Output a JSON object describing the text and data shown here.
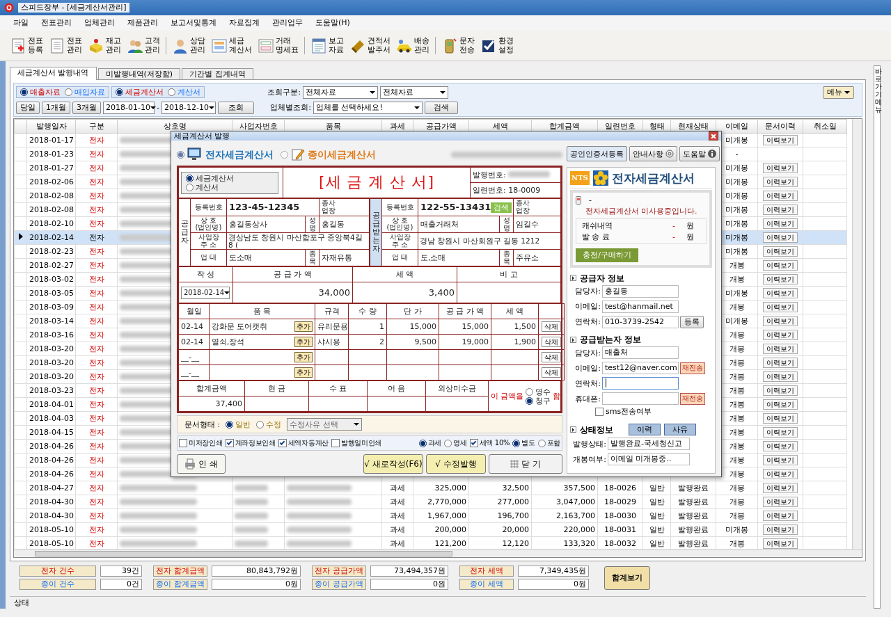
{
  "window": {
    "title": "스피드장부 - [세금계산서관리]"
  },
  "menu": [
    "파일",
    "전표관리",
    "업체관리",
    "제품관리",
    "보고서및통계",
    "자료집계",
    "관리업무",
    "도움말(H)"
  ],
  "toolbar_groups": [
    [
      "전표\n등록",
      "전표\n관리",
      "재고\n관리",
      "고객\n관리"
    ],
    [
      "상담\n관리",
      "세금\n계산서",
      "거래\n명세표"
    ],
    [
      "보고\n자료",
      "견적서\n발주서",
      "배송\n관리"
    ],
    [
      "문자\n전송",
      "환경\n설정"
    ]
  ],
  "side_tab": "바로가기 메뉴",
  "tabs": [
    {
      "label": "세금계산서 발행내역",
      "selected": true
    },
    {
      "label": "미발행내역(저장함)",
      "selected": false
    },
    {
      "label": "기간별 집계내역",
      "selected": false
    }
  ],
  "filters": {
    "source": [
      {
        "label": "매출자료",
        "selected": true,
        "kind": "sales"
      },
      {
        "label": "매입자료",
        "selected": false,
        "kind": "purchase"
      }
    ],
    "doc_type": [
      {
        "label": "세금계산서",
        "selected": true,
        "kind": "sales"
      },
      {
        "label": "계산서",
        "selected": false,
        "kind": "purchase"
      }
    ],
    "period_buttons": [
      "당일",
      "1개월",
      "3개월"
    ],
    "date_from": "2018-01-10",
    "date_sep": "-",
    "date_to": "2018-12-10",
    "search_button": "조회",
    "query_label": "조회구분:",
    "query_select_1": "전체자료",
    "query_select_2": "전체자료",
    "company_label": "업체별조회:",
    "company_select": "업체를 선택하세요!",
    "company_search_button": "검색",
    "menu_button": "메뉴"
  },
  "table": {
    "columns": [
      "발행일자",
      "구분",
      "상호명",
      "사업자번호",
      "품목",
      "과세",
      "공급가액",
      "세액",
      "합계금액",
      "일련번호",
      "형태",
      "현재상태",
      "이메일",
      "문서이력",
      "취소일"
    ],
    "rows": [
      {
        "date": "2018-01-17",
        "kind": "전자",
        "email": "미개봉",
        "history_button": "이력보기",
        "selected": false
      },
      {
        "date": "2018-01-23",
        "kind": "전자",
        "email": "-",
        "selected": false
      },
      {
        "date": "2018-01-27",
        "kind": "전자",
        "email": "미개봉",
        "history_button": "이력보기",
        "selected": false
      },
      {
        "date": "2018-02-06",
        "kind": "전자",
        "email": "미개봉",
        "history_button": "이력보기",
        "selected": false
      },
      {
        "date": "2018-02-08",
        "kind": "전자",
        "email": "미개봉",
        "history_button": "이력보기",
        "selected": false
      },
      {
        "date": "2018-02-08",
        "kind": "전자",
        "email": "미개봉",
        "history_button": "이력보기",
        "selected": false
      },
      {
        "date": "2018-02-10",
        "kind": "전자",
        "email": "미개봉",
        "history_button": "이력보기",
        "selected": false
      },
      {
        "date": "2018-02-14",
        "kind": "전자",
        "email": "미개봉",
        "history_button": "이력보기",
        "selected": true
      },
      {
        "date": "2018-02-23",
        "kind": "전자",
        "email": "미개봉",
        "history_button": "이력보기",
        "selected": false
      },
      {
        "date": "2018-02-27",
        "kind": "전자",
        "email": "개봉",
        "history_button": "이력보기",
        "selected": false
      },
      {
        "date": "2018-03-02",
        "kind": "전자",
        "email": "개봉",
        "history_button": "이력보기",
        "selected": false
      },
      {
        "date": "2018-03-05",
        "kind": "전자",
        "email": "미개봉",
        "history_button": "이력보기",
        "selected": false
      },
      {
        "date": "2018-03-09",
        "kind": "전자",
        "email": "개봉",
        "history_button": "이력보기",
        "selected": false
      },
      {
        "date": "2018-03-14",
        "kind": "전자",
        "email": "미개봉",
        "history_button": "이력보기",
        "selected": false
      },
      {
        "date": "2018-03-16",
        "kind": "전자",
        "email": "개봉",
        "history_button": "이력보기",
        "selected": false
      },
      {
        "date": "2018-03-20",
        "kind": "전자",
        "email": "개봉",
        "history_button": "이력보기",
        "selected": false
      },
      {
        "date": "2018-03-20",
        "kind": "전자",
        "email": "개봉",
        "history_button": "이력보기",
        "selected": false
      },
      {
        "date": "2018-03-20",
        "kind": "전자",
        "email": "개봉",
        "history_button": "이력보기",
        "selected": false
      },
      {
        "date": "2018-03-23",
        "kind": "전자",
        "email": "개봉",
        "history_button": "이력보기",
        "selected": false
      },
      {
        "date": "2018-04-01",
        "kind": "전자",
        "email": "개봉",
        "history_button": "이력보기",
        "selected": false
      },
      {
        "date": "2018-04-03",
        "kind": "전자",
        "email": "개봉",
        "history_button": "이력보기",
        "selected": false
      },
      {
        "date": "2018-04-15",
        "kind": "전자",
        "email": "개봉",
        "history_button": "이력보기",
        "selected": false
      },
      {
        "date": "2018-04-26",
        "kind": "전자",
        "email": "개봉",
        "history_button": "이력보기",
        "selected": false
      },
      {
        "date": "2018-04-26",
        "kind": "전자",
        "email": "개봉",
        "history_button": "이력보기",
        "selected": false
      },
      {
        "date": "2018-04-26",
        "kind": "전자",
        "email": "개봉",
        "history_button": "이력보기",
        "selected": false
      },
      {
        "date": "2018-04-27",
        "kind": "전자",
        "tax": "과세",
        "supply": "325,000",
        "vat": "32,500",
        "total": "357,500",
        "serial": "18-0026",
        "form": "일반",
        "status": "발행완료",
        "email": "개봉",
        "history_button": "이력보기",
        "selected": false
      },
      {
        "date": "2018-04-30",
        "kind": "전자",
        "tax": "과세",
        "supply": "2,770,000",
        "vat": "277,000",
        "total": "3,047,000",
        "serial": "18-0029",
        "form": "일반",
        "status": "발행완료",
        "email": "개봉",
        "history_button": "이력보기",
        "selected": false
      },
      {
        "date": "2018-04-30",
        "kind": "전자",
        "tax": "과세",
        "supply": "1,967,000",
        "vat": "196,700",
        "total": "2,163,700",
        "serial": "18-0030",
        "form": "일반",
        "status": "발행완료",
        "email": "개봉",
        "history_button": "이력보기",
        "selected": false
      },
      {
        "date": "2018-05-10",
        "kind": "전자",
        "tax": "과세",
        "supply": "200,000",
        "vat": "20,000",
        "total": "220,000",
        "serial": "18-0031",
        "form": "일반",
        "status": "발행완료",
        "email": "미개봉",
        "history_button": "이력보기",
        "selected": false
      },
      {
        "date": "2018-05-10",
        "kind": "전자",
        "tax": "과세",
        "supply": "121,200",
        "vat": "12,120",
        "total": "133,320",
        "serial": "18-0032",
        "form": "일반",
        "status": "발행완료",
        "email": "개봉",
        "history_button": "이력보기",
        "selected": false
      }
    ]
  },
  "summary": [
    {
      "kind": "electronic",
      "items": [
        {
          "label": "전자 건수",
          "value": "39건"
        },
        {
          "label": "전자 합계금액",
          "value": "80,843,792원"
        },
        {
          "label": "전자 공급가액",
          "value": "73,494,357원"
        },
        {
          "label": "전자 세액",
          "value": "7,349,435원"
        }
      ]
    },
    {
      "kind": "paper",
      "items": [
        {
          "label": "종이 건수",
          "value": "0건"
        },
        {
          "label": "종이 합계금액",
          "value": "0원"
        },
        {
          "label": "종이 공급가액",
          "value": "0원"
        },
        {
          "label": "종이 세액",
          "value": "0원"
        }
      ]
    }
  ],
  "summary_button": "합계보기",
  "status_bar": "상태",
  "dialog": {
    "title": "세금계산서 발행",
    "modes": [
      {
        "label": "전자세금계산서",
        "selected": true,
        "kind": "electronic"
      },
      {
        "label": "종이세금계산서",
        "selected": false,
        "kind": "paper"
      }
    ],
    "top_buttons": [
      {
        "label": "공인인증서등록",
        "kind": "plain"
      },
      {
        "label": "안내사항",
        "kind": "guide"
      },
      {
        "label": "도움말",
        "kind": "info"
      }
    ],
    "invoice": {
      "type_options": [
        {
          "label": "세금계산서",
          "selected": true
        },
        {
          "label": "계산서",
          "selected": false
        }
      ],
      "heading": "[세 금 계 산 서]",
      "issue_no_label": "발행번호:",
      "serial_label": "일련번호:",
      "serial": "18-0009",
      "supplier": {
        "side_label": "공급자",
        "reg_label": "등록번호",
        "reg_no": "123-45-12345",
        "branch_label": "종사업장",
        "name_label": "상 호\n(법인명)",
        "name": "홍길동상사",
        "rep_label": "성명",
        "rep": "홍길동",
        "addr_label": "사업장\n주 소",
        "addr": "경상남도 창원시 마산합포구 중앙북4길 8 (",
        "biz_label": "업 태",
        "biz": "도소매",
        "item_label": "종목",
        "item": "자재유통"
      },
      "buyer": {
        "side_label": "공급받는자",
        "reg_label": "등록번호",
        "reg_no": "122-55-13431",
        "search_button": "검색",
        "branch_label": "종사업장",
        "name_label": "상 호\n(법인명)",
        "name": "매출거래처",
        "rep_label": "성명",
        "rep": "임길수",
        "addr_label": "사업장\n주 소",
        "addr": "경남 창원시 마산회원구 길동 1212",
        "biz_label": "업 태",
        "biz": "도,소매",
        "item_label": "종목",
        "item": "주유소"
      },
      "amount_header": [
        "작 성",
        "공 급 가 액",
        "세 액",
        "비 고"
      ],
      "issue_date": "2018-02-14",
      "supply": "34,000",
      "vat": "3,400",
      "lines_header": [
        "월일",
        "품 목",
        "규격",
        "수 량",
        "단 가",
        "공 급 가 액",
        "세 액"
      ],
      "lines": [
        {
          "date": "02-14",
          "item": "강화문 도어캣취",
          "add_button": "추가",
          "spec": "유리문용",
          "qty": "1",
          "price": "15,000",
          "supply": "15,000",
          "vat": "1,500",
          "delete_button": "삭제"
        },
        {
          "date": "02-14",
          "item": "열쇠,장석",
          "add_button": "추가",
          "spec": "샤시용",
          "qty": "2",
          "price": "9,500",
          "supply": "19,000",
          "vat": "1,900",
          "delete_button": "삭제"
        },
        {
          "date": "__-__",
          "add_button": "추가",
          "delete_button": "삭제"
        },
        {
          "date": "__-__",
          "add_button": "추가",
          "delete_button": "삭제"
        }
      ],
      "totals_header": [
        "합계금액",
        "현 금",
        "수 표",
        "어 음",
        "외상미수금"
      ],
      "total": "37,400",
      "claim_prefix": "이 금액을",
      "claim_options": [
        {
          "label": "영수",
          "selected": false
        },
        {
          "label": "청구",
          "selected": true
        }
      ],
      "claim_suffix": "함"
    },
    "doc_form": {
      "label": "문서형태 :",
      "options": [
        {
          "label": "일반",
          "selected": true
        },
        {
          "label": "수정",
          "selected": false
        }
      ],
      "reason_select": "수정사유 선택"
    },
    "print_options": [
      {
        "label": "미저장인쇄",
        "checked": false
      },
      {
        "label": "계좌정보인쇄",
        "checked": true
      },
      {
        "label": "세액자동계산",
        "checked": true
      },
      {
        "label": "발행일미인쇄",
        "checked": false
      }
    ],
    "tax_options": [
      {
        "label": "과세",
        "selected": true
      },
      {
        "label": "영세",
        "selected": false
      }
    ],
    "vat_rate": {
      "label": "세액  10%",
      "checked": true
    },
    "vat_incl": [
      {
        "label": "별도",
        "selected": true
      },
      {
        "label": "포함",
        "selected": false
      }
    ],
    "print_button": "인 쇄",
    "action_buttons": [
      {
        "label": "√ 새로작성(F6)",
        "kind": "action"
      },
      {
        "label": "√ 수정발행",
        "kind": "action"
      },
      {
        "label": "닫 기",
        "kind": "close"
      }
    ],
    "nts": {
      "logo_text": "NTS",
      "title": "전자세금계산서",
      "dash": "-",
      "notice": "전자세금계산서 미사용중입니다.",
      "rows": [
        {
          "label": "캐쉬내역",
          "value": "-",
          "unit": "원"
        },
        {
          "label": "발 송 료",
          "value": "-",
          "unit": "원"
        }
      ],
      "charge_button": "충전/구매하기"
    },
    "supplier_info": {
      "title": "공급자 정보",
      "fields": [
        {
          "label": "담당자:",
          "value": "홍길동",
          "focused": false
        },
        {
          "label": "이메일:",
          "value": "test@hanmail.net",
          "focused": false
        },
        {
          "label": "연락처:",
          "value": "010-3739-2542",
          "focused": false,
          "button": {
            "label": "등록",
            "kind": "plain"
          }
        }
      ]
    },
    "buyer_info": {
      "title": "공급받는자 정보",
      "fields": [
        {
          "label": "담당자:",
          "value": "매출처",
          "focused": false
        },
        {
          "label": "이메일:",
          "value": "test12@naver.com",
          "focused": false,
          "button": {
            "label": "재전송",
            "kind": "resend"
          }
        },
        {
          "label": "연락처:",
          "focused": true
        },
        {
          "label": "휴대폰:",
          "focused": false,
          "button": {
            "label": "재전송",
            "kind": "resend"
          }
        }
      ],
      "sms": {
        "label": "sms전송여부",
        "checked": false
      }
    },
    "status_info": {
      "title": "상태정보",
      "buttons": [
        "이력",
        "사유"
      ],
      "fields": [
        {
          "label": "발행상태:",
          "value": "발행완료-국세청신고"
        },
        {
          "label": "개봉여부:",
          "value": "이메일 미개봉중.."
        }
      ]
    }
  }
}
